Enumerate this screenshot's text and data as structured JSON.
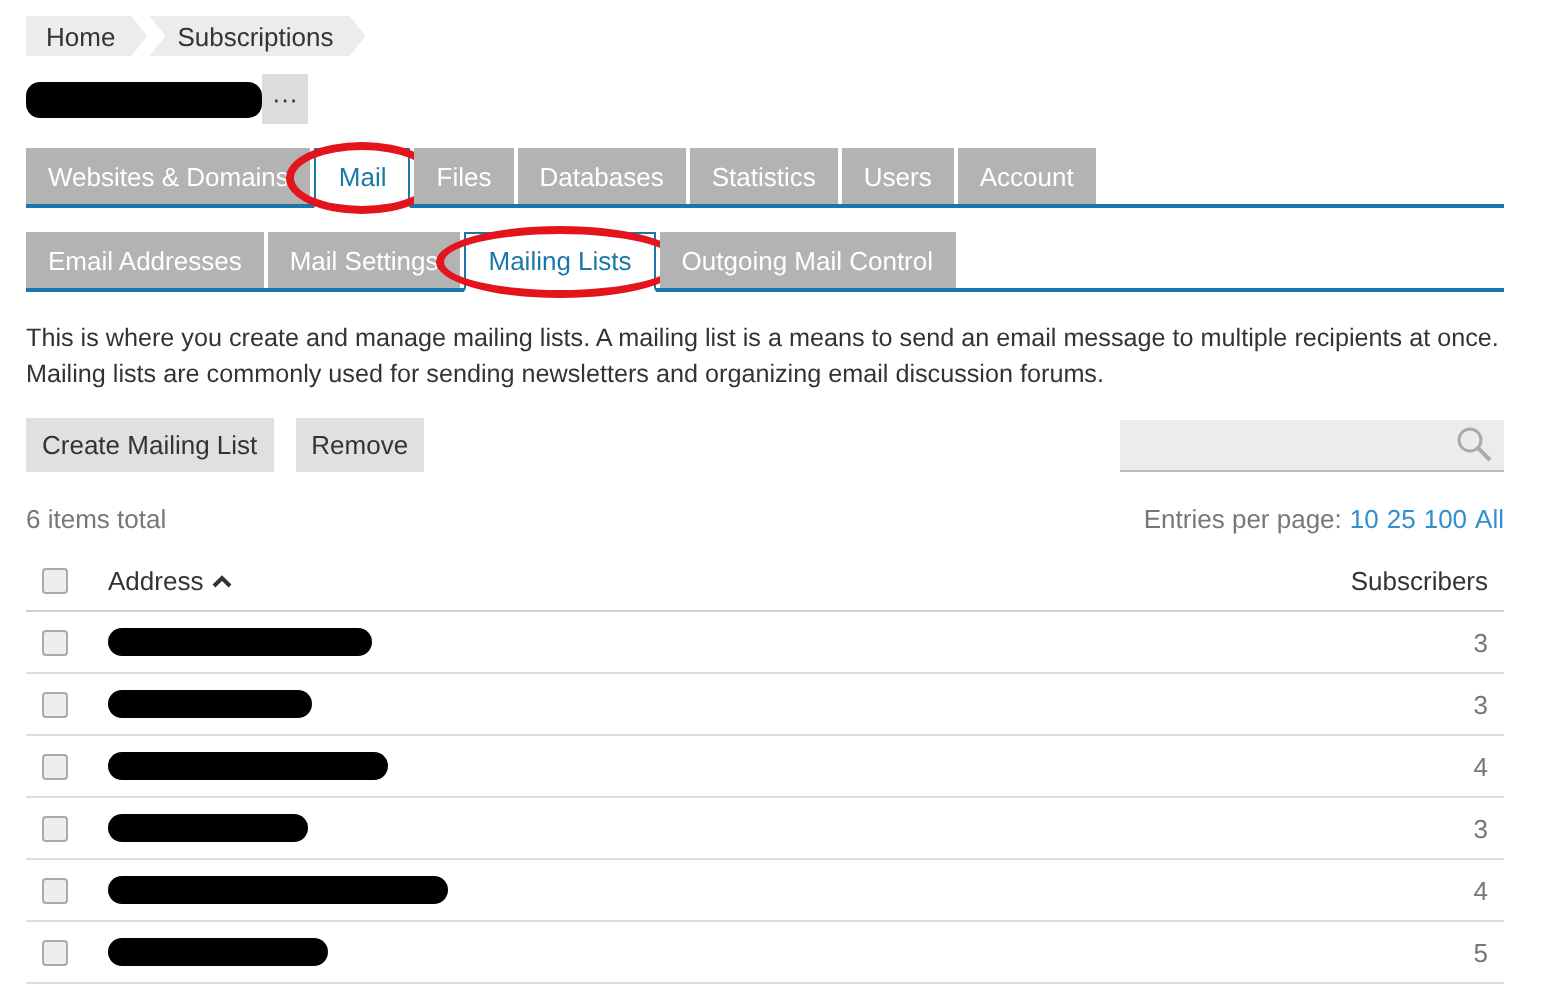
{
  "breadcrumbs": [
    {
      "label": "Home"
    },
    {
      "label": "Subscriptions"
    }
  ],
  "title": {
    "redacted": true,
    "more_button": "···"
  },
  "tabs": [
    {
      "label": "Websites & Domains",
      "selected": false,
      "circled": false
    },
    {
      "label": "Mail",
      "selected": true,
      "circled": true
    },
    {
      "label": "Files",
      "selected": false,
      "circled": false
    },
    {
      "label": "Databases",
      "selected": false,
      "circled": false
    },
    {
      "label": "Statistics",
      "selected": false,
      "circled": false
    },
    {
      "label": "Users",
      "selected": false,
      "circled": false
    },
    {
      "label": "Account",
      "selected": false,
      "circled": false
    }
  ],
  "subtabs": [
    {
      "label": "Email Addresses",
      "selected": false,
      "circled": false
    },
    {
      "label": "Mail Settings",
      "selected": false,
      "circled": false
    },
    {
      "label": "Mailing Lists",
      "selected": true,
      "circled": true
    },
    {
      "label": "Outgoing Mail Control",
      "selected": false,
      "circled": false
    }
  ],
  "description": "This is where you create and manage mailing lists. A mailing list is a means to send an email message to multiple recipients at once. Mailing lists are commonly used for sending newsletters and organizing email discussion forums.",
  "buttons": [
    "Create Mailing List",
    "Remove"
  ],
  "total": "6 items total",
  "entries_per_page": {
    "label": "Entries per page:",
    "options": [
      "10",
      "25",
      "100",
      "All"
    ]
  },
  "table": {
    "select_all_checked": false,
    "columns": [
      {
        "label": "Address",
        "sorted": true
      },
      {
        "label": "Subscribers"
      }
    ],
    "rows": [
      {
        "checked": false,
        "subscribers": "3"
      },
      {
        "checked": false,
        "subscribers": "3"
      },
      {
        "checked": false,
        "subscribers": "4"
      },
      {
        "checked": false,
        "subscribers": "3"
      },
      {
        "checked": false,
        "subscribers": "4"
      },
      {
        "checked": false,
        "subscribers": "5"
      }
    ]
  }
}
